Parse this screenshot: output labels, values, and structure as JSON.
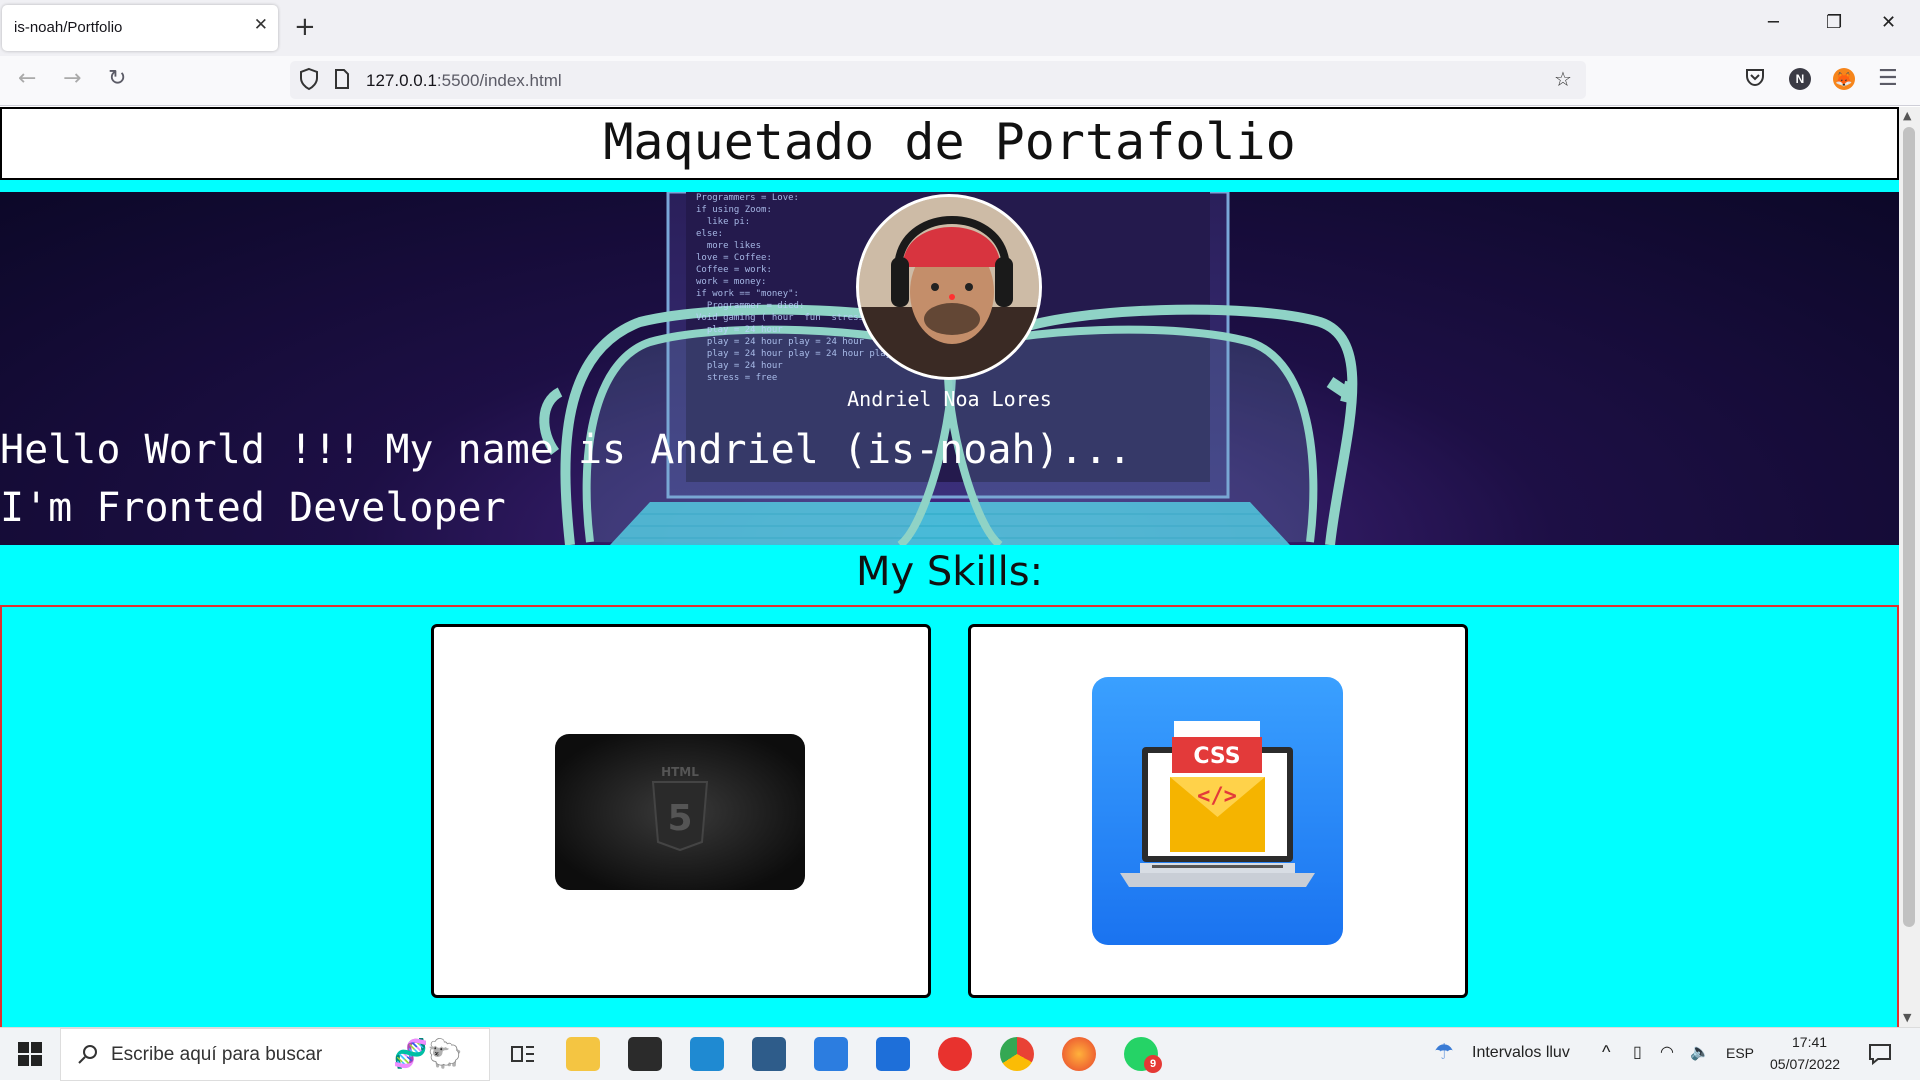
{
  "browser": {
    "tab_title": "is-noah/Portfolio",
    "tab_close": "✕",
    "new_tab": "+",
    "url_host": "127.0.0.1",
    "url_path": ":5500/index.html",
    "profile_initial": "N"
  },
  "page": {
    "title": "Maquetado de Portafolio",
    "avatar_name": "Andriel Noa Lores",
    "hero_line1": "Hello World !!! My name is Andriel (is-noah)...",
    "hero_line2": "I'm Fronted Developer",
    "skills_title": "My Skills:",
    "skills": [
      {
        "name": "HTML5",
        "icon": "html5-icon",
        "badge": "5",
        "label": "HTML"
      },
      {
        "name": "CSS",
        "icon": "css-laptop-icon",
        "badge": "CSS",
        "code": "</>"
      }
    ]
  },
  "code_lines": [
    "Programmers = Love:",
    "if using Zoom:",
    "  like pi:",
    "else:",
    "  more likes",
    "love = Coffee:",
    "Coffee = work:",
    "work = money:",
    "if work == \"money\":",
    "  Programmer = died:",
    "Void gaming ( hour  fun  stress ):",
    "  play = 24 hour",
    "  play = 24 hour play = 24 hour",
    "  play = 24 hour play = 24 hour play = 24",
    "  play = 24 hour",
    "  stress = free"
  ],
  "taskbar": {
    "search_placeholder": "Escribe aquí para buscar",
    "weather": "Intervalos lluv",
    "language": "ESP",
    "time": "17:41",
    "date": "05/07/2022",
    "whatsapp_badge": "9"
  },
  "colors": {
    "page_bg": "#00ffff",
    "skills_border": "#e03030",
    "hero_bg": "#1d0f45"
  }
}
